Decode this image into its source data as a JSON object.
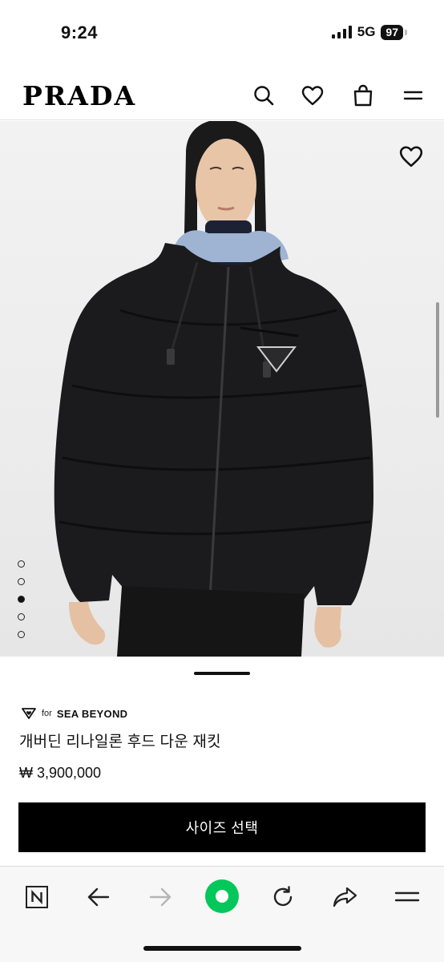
{
  "status_bar": {
    "time": "9:24",
    "network": "5G",
    "battery": "97"
  },
  "header": {
    "logo": "PRADA",
    "icons": [
      "search-icon",
      "heart-icon",
      "shopping-bag-icon",
      "menu-icon"
    ]
  },
  "gallery": {
    "slide_count": 5,
    "active_index": 2
  },
  "product": {
    "brand_for": "for",
    "brand_program": "SEA BEYOND",
    "name": "개버딘 리나일론 후드 다운 재킷",
    "price": "₩ 3,900,000",
    "size_button_label": "사이즈 선택"
  },
  "browser_toolbar": {
    "icons": [
      "naver-n-icon",
      "back-arrow-icon",
      "forward-arrow-icon",
      "green-home-icon",
      "reload-icon",
      "share-icon",
      "menu-icon"
    ]
  },
  "colors": {
    "accent_green": "#03c75a",
    "button_black": "#000000"
  }
}
